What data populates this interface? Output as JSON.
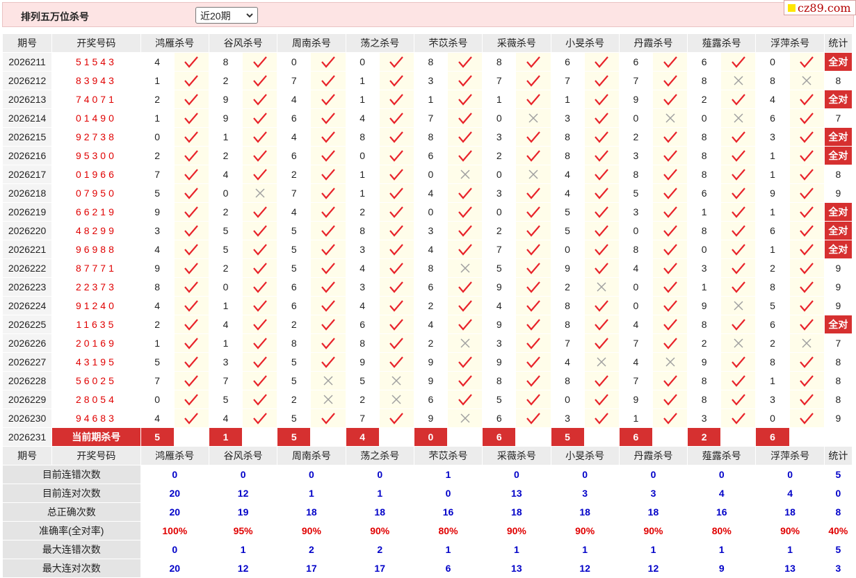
{
  "header": {
    "title": "排列五万位杀号",
    "period_select": "近20期"
  },
  "logo": {
    "text": "cz89.com"
  },
  "columns": {
    "period": "期号",
    "winning": "开奖号码",
    "experts": [
      "鸿雁杀号",
      "谷风杀号",
      "周南杀号",
      "荡之杀号",
      "芣苡杀号",
      "采薇杀号",
      "小旻杀号",
      "丹霞杀号",
      "薤露杀号",
      "浮萍杀号"
    ],
    "stats": "统计"
  },
  "rows": [
    {
      "period": "2026211",
      "winning": "51543",
      "kills": [
        4,
        8,
        0,
        0,
        8,
        8,
        6,
        6,
        6,
        0
      ],
      "marks": "RRRRRRRRRR",
      "stat": "全对"
    },
    {
      "period": "2026212",
      "winning": "83943",
      "kills": [
        1,
        2,
        7,
        1,
        3,
        7,
        7,
        7,
        8,
        8
      ],
      "marks": "RRRRRRRRWW",
      "stat": "8"
    },
    {
      "period": "2026213",
      "winning": "74071",
      "kills": [
        2,
        9,
        4,
        1,
        1,
        1,
        1,
        9,
        2,
        4
      ],
      "marks": "RRRRRRRRRR",
      "stat": "全对"
    },
    {
      "period": "2026214",
      "winning": "01490",
      "kills": [
        1,
        9,
        6,
        4,
        7,
        0,
        3,
        0,
        0,
        6
      ],
      "marks": "RRRRRWRWWR",
      "stat": "7"
    },
    {
      "period": "2026215",
      "winning": "92738",
      "kills": [
        0,
        1,
        4,
        8,
        8,
        3,
        8,
        2,
        8,
        3
      ],
      "marks": "RRRRRRRRRR",
      "stat": "全对"
    },
    {
      "period": "2026216",
      "winning": "95300",
      "kills": [
        2,
        2,
        6,
        0,
        6,
        2,
        8,
        3,
        8,
        1
      ],
      "marks": "RRRRRRRRRR",
      "stat": "全对"
    },
    {
      "period": "2026217",
      "winning": "01966",
      "kills": [
        7,
        4,
        2,
        1,
        0,
        0,
        4,
        8,
        8,
        1
      ],
      "marks": "RRRRWWRRRR",
      "stat": "8"
    },
    {
      "period": "2026218",
      "winning": "07950",
      "kills": [
        5,
        0,
        7,
        1,
        4,
        3,
        4,
        5,
        6,
        9
      ],
      "marks": "RWRRRRRRRR",
      "stat": "9"
    },
    {
      "period": "2026219",
      "winning": "66219",
      "kills": [
        9,
        2,
        4,
        2,
        0,
        0,
        5,
        3,
        1,
        1
      ],
      "marks": "RRRRRRRRRR",
      "stat": "全对"
    },
    {
      "period": "2026220",
      "winning": "48299",
      "kills": [
        3,
        5,
        5,
        8,
        3,
        2,
        5,
        0,
        8,
        6
      ],
      "marks": "RRRRRRRRRR",
      "stat": "全对"
    },
    {
      "period": "2026221",
      "winning": "96988",
      "kills": [
        4,
        5,
        5,
        3,
        4,
        7,
        0,
        8,
        0,
        1
      ],
      "marks": "RRRRRRRRRR",
      "stat": "全对"
    },
    {
      "period": "2026222",
      "winning": "87771",
      "kills": [
        9,
        2,
        5,
        4,
        8,
        5,
        9,
        4,
        3,
        2
      ],
      "marks": "RRRRWRRRRR",
      "stat": "9"
    },
    {
      "period": "2026223",
      "winning": "22373",
      "kills": [
        8,
        0,
        6,
        3,
        6,
        9,
        2,
        0,
        1,
        8
      ],
      "marks": "RRRRRRWRRR",
      "stat": "9"
    },
    {
      "period": "2026224",
      "winning": "91240",
      "kills": [
        4,
        1,
        6,
        4,
        2,
        4,
        8,
        0,
        9,
        5
      ],
      "marks": "RRRRRRRRWR",
      "stat": "9"
    },
    {
      "period": "2026225",
      "winning": "11635",
      "kills": [
        2,
        4,
        2,
        6,
        4,
        9,
        8,
        4,
        8,
        6
      ],
      "marks": "RRRRRRRRRR",
      "stat": "全对"
    },
    {
      "period": "2026226",
      "winning": "20169",
      "kills": [
        1,
        1,
        8,
        8,
        2,
        3,
        7,
        7,
        2,
        2
      ],
      "marks": "RRRRWRRRWW",
      "stat": "7"
    },
    {
      "period": "2026227",
      "winning": "43195",
      "kills": [
        5,
        3,
        5,
        9,
        9,
        9,
        4,
        4,
        9,
        8
      ],
      "marks": "RRRRRRWWRR",
      "stat": "8"
    },
    {
      "period": "2026228",
      "winning": "56025",
      "kills": [
        7,
        7,
        5,
        5,
        9,
        8,
        8,
        7,
        8,
        1
      ],
      "marks": "RRWWRRRRRR",
      "stat": "8"
    },
    {
      "period": "2026229",
      "winning": "28054",
      "kills": [
        0,
        5,
        2,
        2,
        6,
        5,
        0,
        9,
        8,
        3
      ],
      "marks": "RRWWRRRRRR",
      "stat": "8"
    },
    {
      "period": "2026230",
      "winning": "94683",
      "kills": [
        4,
        4,
        5,
        7,
        9,
        6,
        3,
        1,
        3,
        0
      ],
      "marks": "RRRRWRRRRR",
      "stat": "9"
    }
  ],
  "current": {
    "period": "2026231",
    "label": "当前期杀号",
    "kills": [
      5,
      1,
      5,
      4,
      0,
      6,
      5,
      6,
      2,
      6
    ]
  },
  "summary": [
    {
      "label": "目前连错次数",
      "values": [
        "0",
        "0",
        "0",
        "0",
        "1",
        "0",
        "0",
        "0",
        "0",
        "0"
      ],
      "stat": "5",
      "color": "blue"
    },
    {
      "label": "目前连对次数",
      "values": [
        "20",
        "12",
        "1",
        "1",
        "0",
        "13",
        "3",
        "3",
        "4",
        "4"
      ],
      "stat": "0",
      "color": "blue"
    },
    {
      "label": "总正确次数",
      "values": [
        "20",
        "19",
        "18",
        "18",
        "16",
        "18",
        "18",
        "18",
        "16",
        "18"
      ],
      "stat": "8",
      "color": "blue"
    },
    {
      "label": "准确率(全对率)",
      "values": [
        "100%",
        "95%",
        "90%",
        "90%",
        "80%",
        "90%",
        "90%",
        "90%",
        "80%",
        "90%"
      ],
      "stat": "40%",
      "color": "red"
    },
    {
      "label": "最大连错次数",
      "values": [
        "0",
        "1",
        "2",
        "2",
        "1",
        "1",
        "1",
        "1",
        "1",
        "1"
      ],
      "stat": "5",
      "color": "blue"
    },
    {
      "label": "最大连对次数",
      "values": [
        "20",
        "12",
        "17",
        "17",
        "6",
        "13",
        "12",
        "12",
        "9",
        "13"
      ],
      "stat": "3",
      "color": "blue"
    }
  ],
  "colors": {
    "accent": "#d63030",
    "right": "#e8232a",
    "wrong": "#a0a0a0",
    "blue_value": "#0000c8",
    "red_value": "#e00000"
  },
  "icons": {
    "right": "check-icon",
    "wrong": "cross-icon",
    "select": "chevron-down-icon"
  }
}
